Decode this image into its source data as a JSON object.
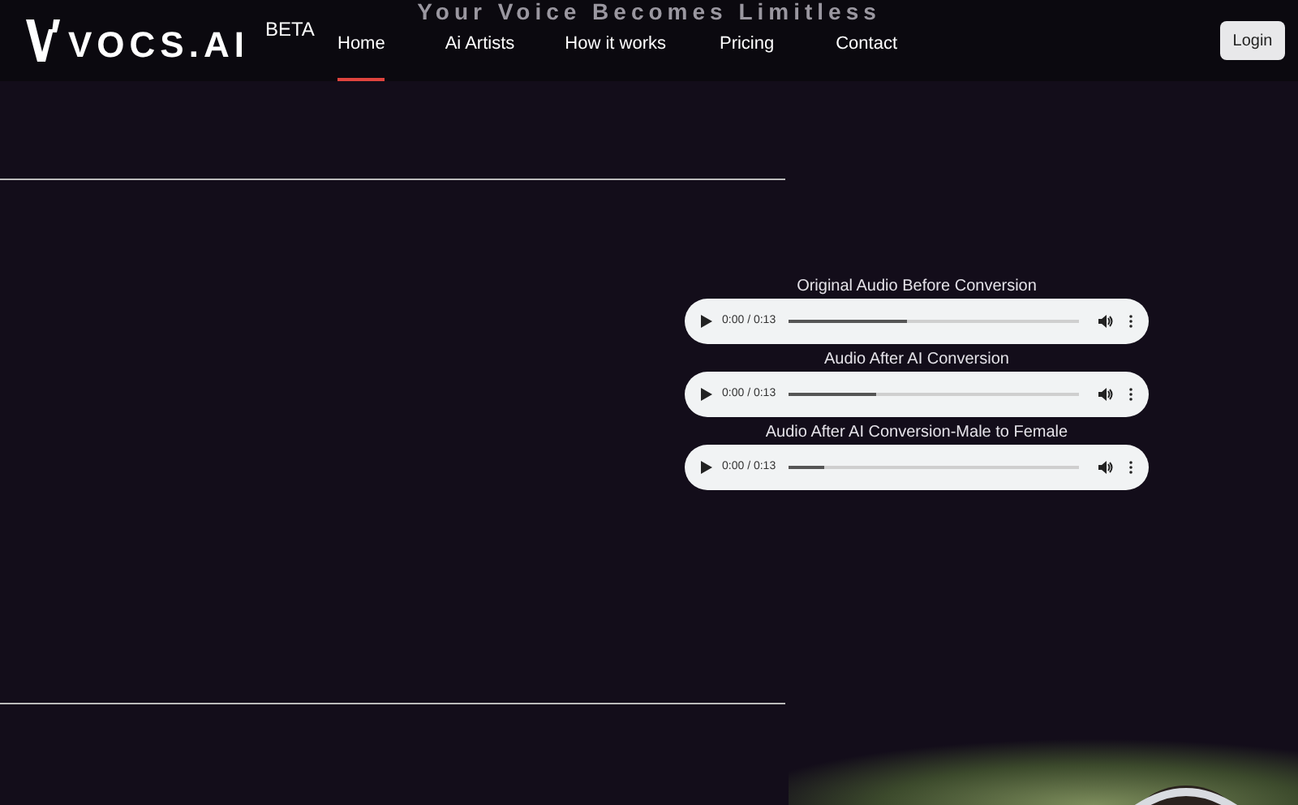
{
  "hero": {
    "heading": "Your Voice Becomes Limitless"
  },
  "header": {
    "logo": "VOCS.AI",
    "badge": "BETA",
    "nav": [
      {
        "label": "Home",
        "selected": true
      },
      {
        "label": "Ai Artists",
        "selected": false
      },
      {
        "label": "How it works",
        "selected": false
      },
      {
        "label": "Pricing",
        "selected": false
      },
      {
        "label": "Contact",
        "selected": false
      }
    ],
    "login": "Login"
  },
  "samples": [
    {
      "title": "Original Audio Before Conversion",
      "time": "0:00 / 0:13",
      "level": 0.41
    },
    {
      "title": "Audio After AI Conversion",
      "time": "0:00 / 0:13",
      "level": 0.3
    },
    {
      "title": "Audio After AI Conversion-Male to Female",
      "time": "0:00 / 0:13",
      "level": 0.12
    }
  ]
}
